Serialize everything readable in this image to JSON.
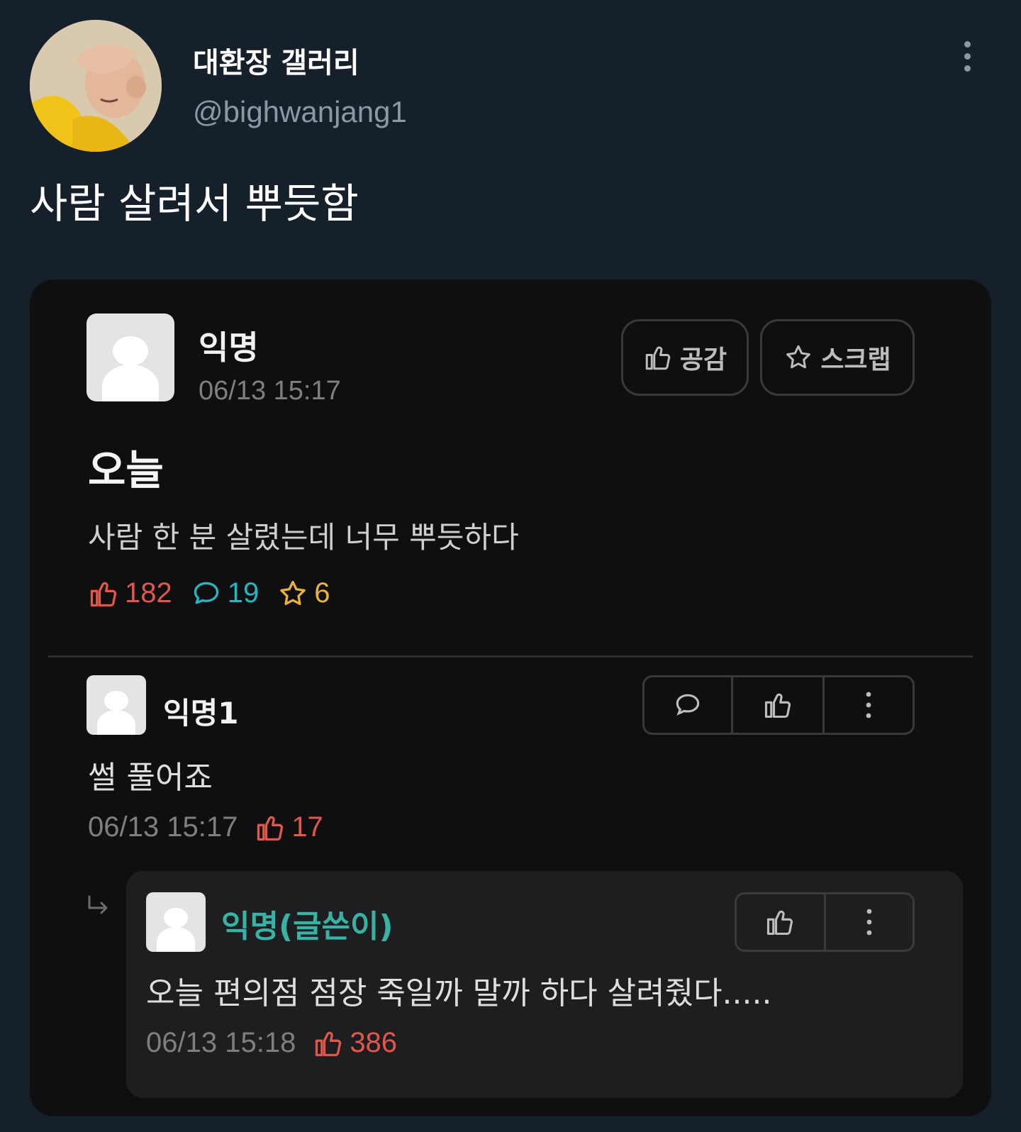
{
  "tweet": {
    "display_name": "대환장 갤러리",
    "handle": "@bighwanjang1",
    "text": "사람 살려서 뿌듯함"
  },
  "post": {
    "author": "익명",
    "date": "06/13 15:17",
    "like_button_label": "공감",
    "scrap_button_label": "스크랩",
    "title": "오늘",
    "body": "사람 한 분 살렸는데 너무 뿌듯하다",
    "likes": "182",
    "comments": "19",
    "scraps": "6"
  },
  "comment": {
    "author": "익명1",
    "text": "썰 풀어죠",
    "date": "06/13 15:17",
    "likes": "17"
  },
  "reply": {
    "author": "익명(글쓴이)",
    "text": "오늘 편의점 점장 죽일까 말까 하다 살려줬다.....",
    "date": "06/13 15:18",
    "likes": "386"
  },
  "colors": {
    "background": "#15202b",
    "card": "#0f0f11",
    "like_red": "#e2574c",
    "comment_teal": "#22b8c2",
    "scrap_yellow": "#e9b23a",
    "author_teal": "#38b2a4"
  },
  "icons": [
    "more-vertical-icon",
    "thumbs-up-icon",
    "star-icon",
    "speech-bubble-icon",
    "reply-arrow-icon"
  ]
}
